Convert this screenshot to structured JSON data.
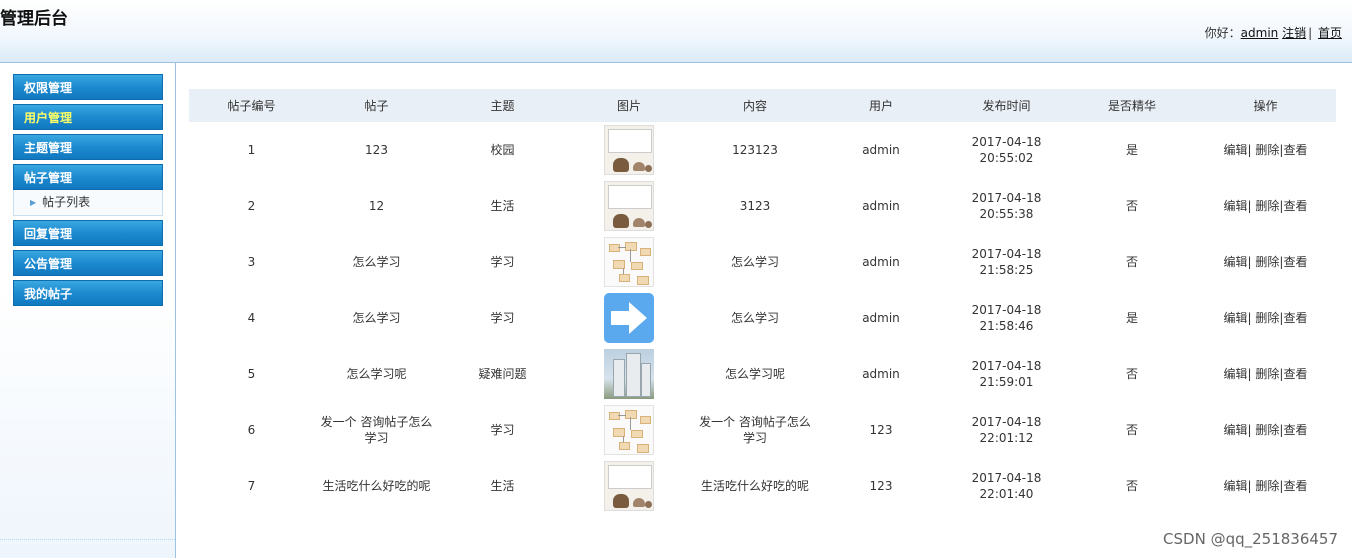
{
  "header": {
    "title": "管理后台",
    "greeting": "你好：",
    "username": "admin",
    "logout": "注销",
    "home": "首页",
    "separator": "|"
  },
  "sidebar": {
    "menus": [
      {
        "label": "权限管理"
      },
      {
        "label": "用户管理"
      },
      {
        "label": "主题管理"
      },
      {
        "label": "帖子管理",
        "sub": "帖子列表"
      },
      {
        "label": "回复管理"
      },
      {
        "label": "公告管理"
      },
      {
        "label": "我的帖子"
      }
    ]
  },
  "table": {
    "headers": [
      "帖子编号",
      "帖子",
      "主题",
      "图片",
      "内容",
      "用户",
      "发布时间",
      "是否精华",
      "操作"
    ],
    "ops": {
      "edit": "编辑",
      "delete": "删除",
      "view": "查看",
      "sep": "|"
    },
    "rows": [
      {
        "id": "1",
        "post": "123",
        "topic": "校园",
        "image": "bears-icon",
        "content": "123123",
        "user": "admin",
        "date": "2017-04-18",
        "time": "20:55:02",
        "featured": "是"
      },
      {
        "id": "2",
        "post": "12",
        "topic": "生活",
        "image": "bears-icon",
        "content": "3123",
        "user": "admin",
        "date": "2017-04-18",
        "time": "20:55:38",
        "featured": "否"
      },
      {
        "id": "3",
        "post": "怎么学习",
        "topic": "学习",
        "image": "flowchart-icon",
        "content": "怎么学习",
        "user": "admin",
        "date": "2017-04-18",
        "time": "21:58:25",
        "featured": "否"
      },
      {
        "id": "4",
        "post": "怎么学习",
        "topic": "学习",
        "image": "arrow-icon",
        "content": "怎么学习",
        "user": "admin",
        "date": "2017-04-18",
        "time": "21:58:46",
        "featured": "是"
      },
      {
        "id": "5",
        "post": "怎么学习呢",
        "topic": "疑难问题",
        "image": "building-icon",
        "content": "怎么学习呢",
        "user": "admin",
        "date": "2017-04-18",
        "time": "21:59:01",
        "featured": "否"
      },
      {
        "id": "6",
        "post": "发一个 咨询帖子怎么学习",
        "topic": "学习",
        "image": "flowchart-icon",
        "content": "发一个 咨询帖子怎么学习",
        "user": "123",
        "date": "2017-04-18",
        "time": "22:01:12",
        "featured": "否"
      },
      {
        "id": "7",
        "post": "生活吃什么好吃的呢",
        "topic": "生活",
        "image": "bears-icon",
        "content": "生活吃什么好吃的呢",
        "user": "123",
        "date": "2017-04-18",
        "time": "22:01:40",
        "featured": "否"
      }
    ]
  },
  "watermark": "CSDN @qq_251836457"
}
